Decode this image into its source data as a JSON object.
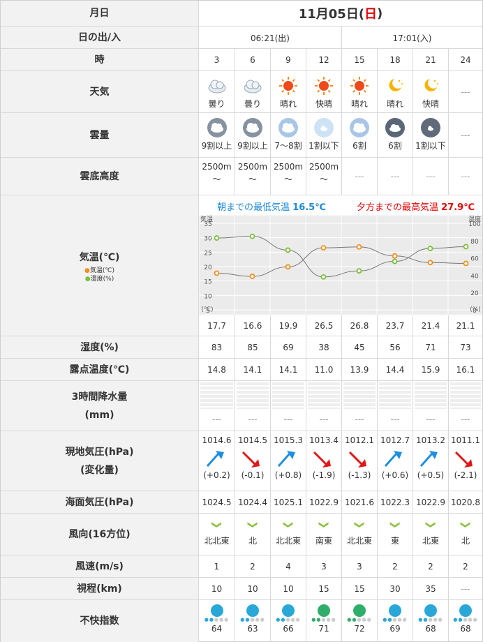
{
  "header": {
    "label": "月日",
    "date": "11月05日(",
    "weekday": "日",
    "close": ")"
  },
  "sun": {
    "label": "日の出/入",
    "rise": "06:21(出)",
    "set": "17:01(入)"
  },
  "hours": {
    "label": "時",
    "values": [
      "3",
      "6",
      "9",
      "12",
      "15",
      "18",
      "21",
      "24"
    ]
  },
  "weather": {
    "label": "天気",
    "items": [
      {
        "icon": "cloud-icon",
        "text": "曇り"
      },
      {
        "icon": "cloud-icon",
        "text": "曇り"
      },
      {
        "icon": "sun-icon",
        "text": "晴れ"
      },
      {
        "icon": "sun-icon",
        "text": "快晴"
      },
      {
        "icon": "sun-icon",
        "text": "晴れ"
      },
      {
        "icon": "moon-cloud-icon",
        "text": "晴れ"
      },
      {
        "icon": "moon-cloud-icon",
        "text": "快晴"
      },
      {
        "icon": "",
        "text": "---"
      }
    ]
  },
  "cloud": {
    "label": "雲量",
    "items": [
      {
        "icon": "overcast-icon",
        "text": "9割以上"
      },
      {
        "icon": "overcast-icon",
        "text": "9割以上"
      },
      {
        "icon": "partly-cloud-icon",
        "text": "7〜8割"
      },
      {
        "icon": "light-cloud-icon",
        "text": "1割以下"
      },
      {
        "icon": "partly-cloud-icon",
        "text": "6割"
      },
      {
        "icon": "night-cloud-icon",
        "text": "6割"
      },
      {
        "icon": "night-clear-icon",
        "text": "1割以下"
      },
      {
        "icon": "",
        "text": "---"
      }
    ]
  },
  "ceiling": {
    "label": "雲底高度",
    "items": [
      "2500m",
      "2500m",
      "2500m",
      "2500m",
      "---",
      "---",
      "---",
      "---"
    ],
    "tilde": "〜"
  },
  "temp": {
    "label": "気温(℃)",
    "legend_temp": "気温(℃)",
    "legend_hum": "湿度(%)",
    "min_label": "朝までの最低気温",
    "min_value": "16.5℃",
    "max_label": "夕方までの最高気温",
    "max_value": "27.9℃",
    "values": [
      "17.7",
      "16.6",
      "19.9",
      "26.5",
      "26.8",
      "23.7",
      "21.4",
      "21.1"
    ]
  },
  "chart_data": {
    "type": "line",
    "categories": [
      "3",
      "6",
      "9",
      "12",
      "15",
      "18",
      "21",
      "24"
    ],
    "series": [
      {
        "name": "気温(℃)",
        "values": [
          17.7,
          16.6,
          19.9,
          26.5,
          26.8,
          23.7,
          21.4,
          21.1
        ],
        "color": "#f0901e"
      },
      {
        "name": "湿度(%)",
        "values": [
          83,
          85,
          69,
          38,
          45,
          56,
          71,
          73
        ],
        "color": "#7bbf3a"
      }
    ],
    "ylim_left": [
      5,
      35
    ],
    "ylim_right": [
      0,
      100
    ],
    "left_ticks": [
      "35",
      "30",
      "25",
      "20",
      "15",
      "10",
      "5"
    ],
    "right_ticks": [
      "100",
      "80",
      "60",
      "40",
      "20",
      "0"
    ],
    "left_unit_top": "気温",
    "left_unit_bottom": "(℃)",
    "right_unit_top": "湿度",
    "right_unit_bottom": "(%)"
  },
  "humidity": {
    "label": "湿度(%)",
    "values": [
      "83",
      "85",
      "69",
      "38",
      "45",
      "56",
      "71",
      "73"
    ]
  },
  "dew": {
    "label": "露点温度(℃)",
    "values": [
      "14.8",
      "14.1",
      "14.1",
      "11.0",
      "13.9",
      "14.4",
      "15.9",
      "16.1"
    ]
  },
  "precip": {
    "label1": "3時間降水量",
    "label2": "(mm)",
    "values": [
      "---",
      "---",
      "---",
      "---",
      "---",
      "---",
      "---",
      "---"
    ]
  },
  "pressure": {
    "label1": "現地気圧(hPa)",
    "label2": "(変化量)",
    "values": [
      "1014.6",
      "1014.5",
      "1015.3",
      "1013.4",
      "1012.1",
      "1012.7",
      "1013.2",
      "1011.1"
    ],
    "changes": [
      "(+0.2)",
      "(-0.1)",
      "(+0.8)",
      "(-1.9)",
      "(-1.3)",
      "(+0.6)",
      "(+0.5)",
      "(-2.1)"
    ],
    "dirs": [
      "up",
      "down",
      "up",
      "down",
      "down",
      "up",
      "up",
      "down"
    ]
  },
  "sea": {
    "label": "海面気圧(hPa)",
    "values": [
      "1024.5",
      "1024.4",
      "1025.1",
      "1022.9",
      "1021.6",
      "1022.3",
      "1022.9",
      "1020.8"
    ]
  },
  "wind": {
    "label": "風向(16方位)",
    "values": [
      "北北東",
      "北",
      "北北東",
      "南東",
      "北北東",
      "東",
      "北東",
      "北"
    ]
  },
  "speed": {
    "label": "風速(m/s)",
    "values": [
      "1",
      "2",
      "4",
      "3",
      "3",
      "2",
      "2",
      "2"
    ]
  },
  "vis": {
    "label": "視程(km)",
    "values": [
      "10",
      "10",
      "10",
      "15",
      "15",
      "30",
      "35",
      "---"
    ]
  },
  "discomfort": {
    "label": "不快指数",
    "values": [
      "64",
      "63",
      "66",
      "71",
      "72",
      "69",
      "68",
      "68"
    ]
  },
  "colors": {
    "sunday": "#e60000",
    "min": "#1e88d8",
    "max": "#e60000",
    "up": "#1e8fe0",
    "down": "#e01818"
  }
}
